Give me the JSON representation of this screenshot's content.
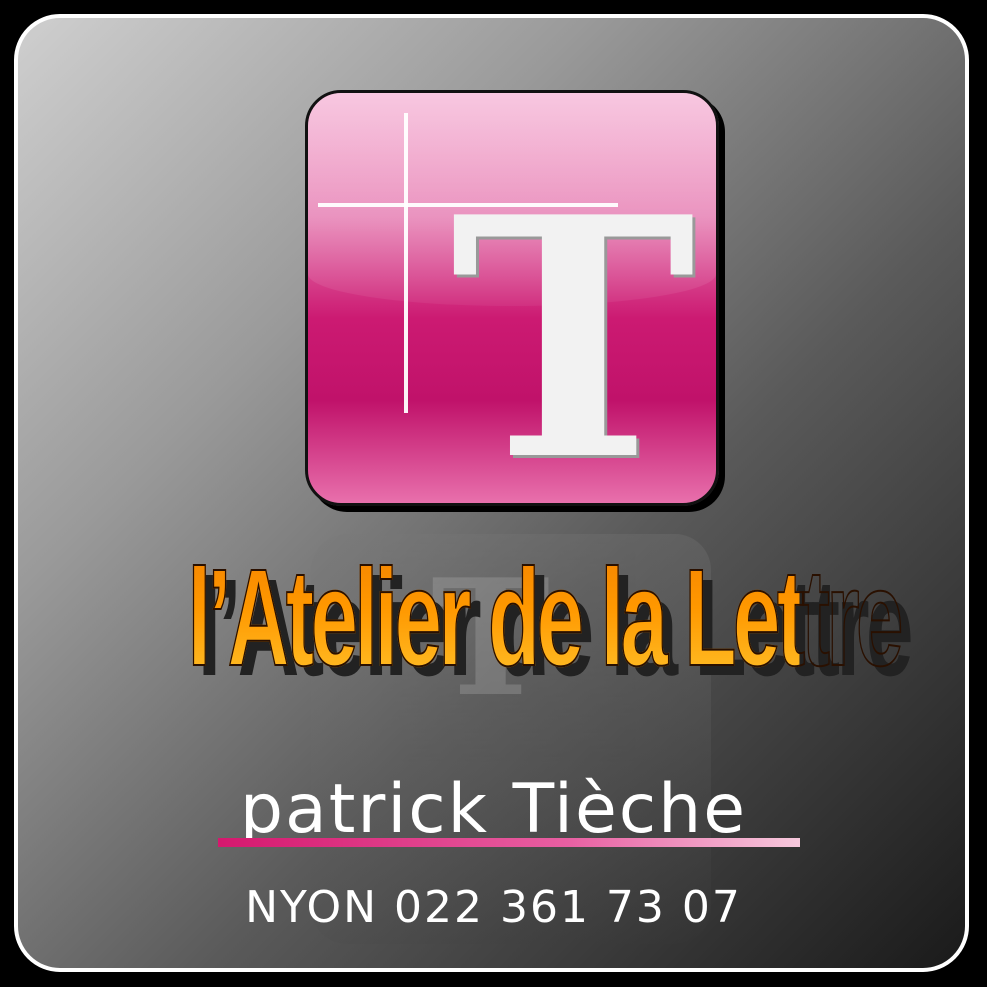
{
  "logo": {
    "letter": "T"
  },
  "headline": "l’Atelier de la Lettre",
  "name": "patrick Tièche",
  "phone": "NYON 022 361 73 07",
  "colors": {
    "logo_pink": "#c0126a",
    "headline_orange": "#ff9800",
    "underline_pink": "#d5186e"
  }
}
